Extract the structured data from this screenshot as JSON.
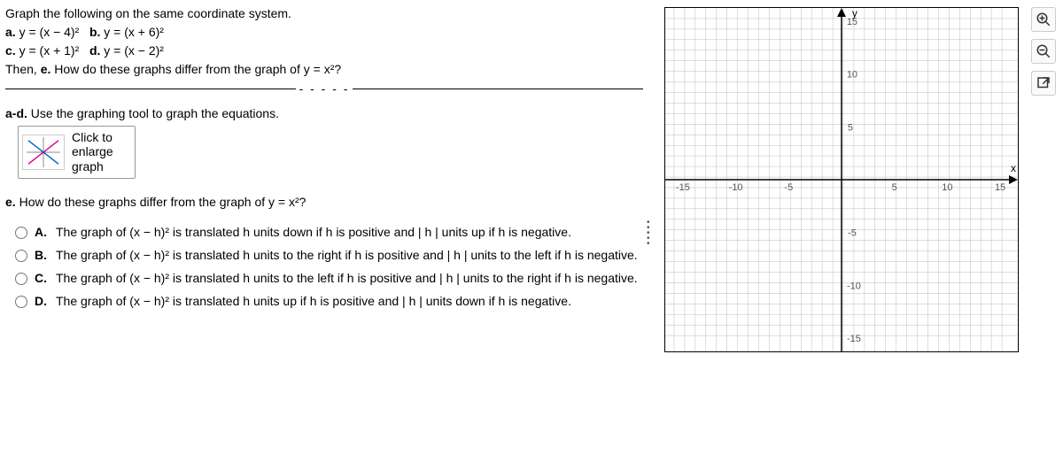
{
  "prompt": {
    "intro": "Graph the following on the same coordinate system.",
    "a_label": "a.",
    "a_eq": "y = (x − 4)²",
    "b_label": "b.",
    "b_eq": "y = (x + 6)²",
    "c_label": "c.",
    "c_eq": "y = (x + 1)²",
    "d_label": "d.",
    "d_eq": "y = (x − 2)²",
    "then_label": "Then,",
    "e_label": "e.",
    "e_text": "How do these graphs differ from the graph of y = x²?"
  },
  "separator_dots": "- - - - -",
  "ad_instruction_prefix": "a-d.",
  "ad_instruction": "Use the graphing tool to graph the equations.",
  "graph_tool": {
    "line1": "Click to",
    "line2": "enlarge",
    "line3": "graph"
  },
  "question_e_prefix": "e.",
  "question_e": "How do these graphs differ from the graph of y = x²?",
  "options": {
    "A": {
      "letter": "A.",
      "text": "The graph of (x − h)² is translated h units down if h is positive and | h | units up if h is negative."
    },
    "B": {
      "letter": "B.",
      "text": "The graph of (x − h)² is translated h units to the right if h is positive and | h | units to the left if h is negative."
    },
    "C": {
      "letter": "C.",
      "text": "The graph of (x − h)² is translated h units to the left if h is positive and | h | units to the right if h is negative."
    },
    "D": {
      "letter": "D.",
      "text": "The graph of (x − h)² is translated h units up if h is positive and | h | units down if h is negative."
    }
  },
  "graph": {
    "x_label": "x",
    "y_label": "y",
    "x_ticks": [
      "-15",
      "-10",
      "-5",
      "5",
      "10",
      "15"
    ],
    "y_ticks": [
      "15",
      "10",
      "5",
      "-5",
      "-10",
      "-15"
    ]
  },
  "chart_data": {
    "type": "scatter",
    "title": "",
    "xlabel": "x",
    "ylabel": "y",
    "xlim": [
      -16,
      16
    ],
    "ylim": [
      -16,
      16
    ],
    "x_ticks": [
      -15,
      -10,
      -5,
      5,
      10,
      15
    ],
    "y_ticks": [
      -15,
      -10,
      -5,
      5,
      10,
      15
    ],
    "series": []
  }
}
